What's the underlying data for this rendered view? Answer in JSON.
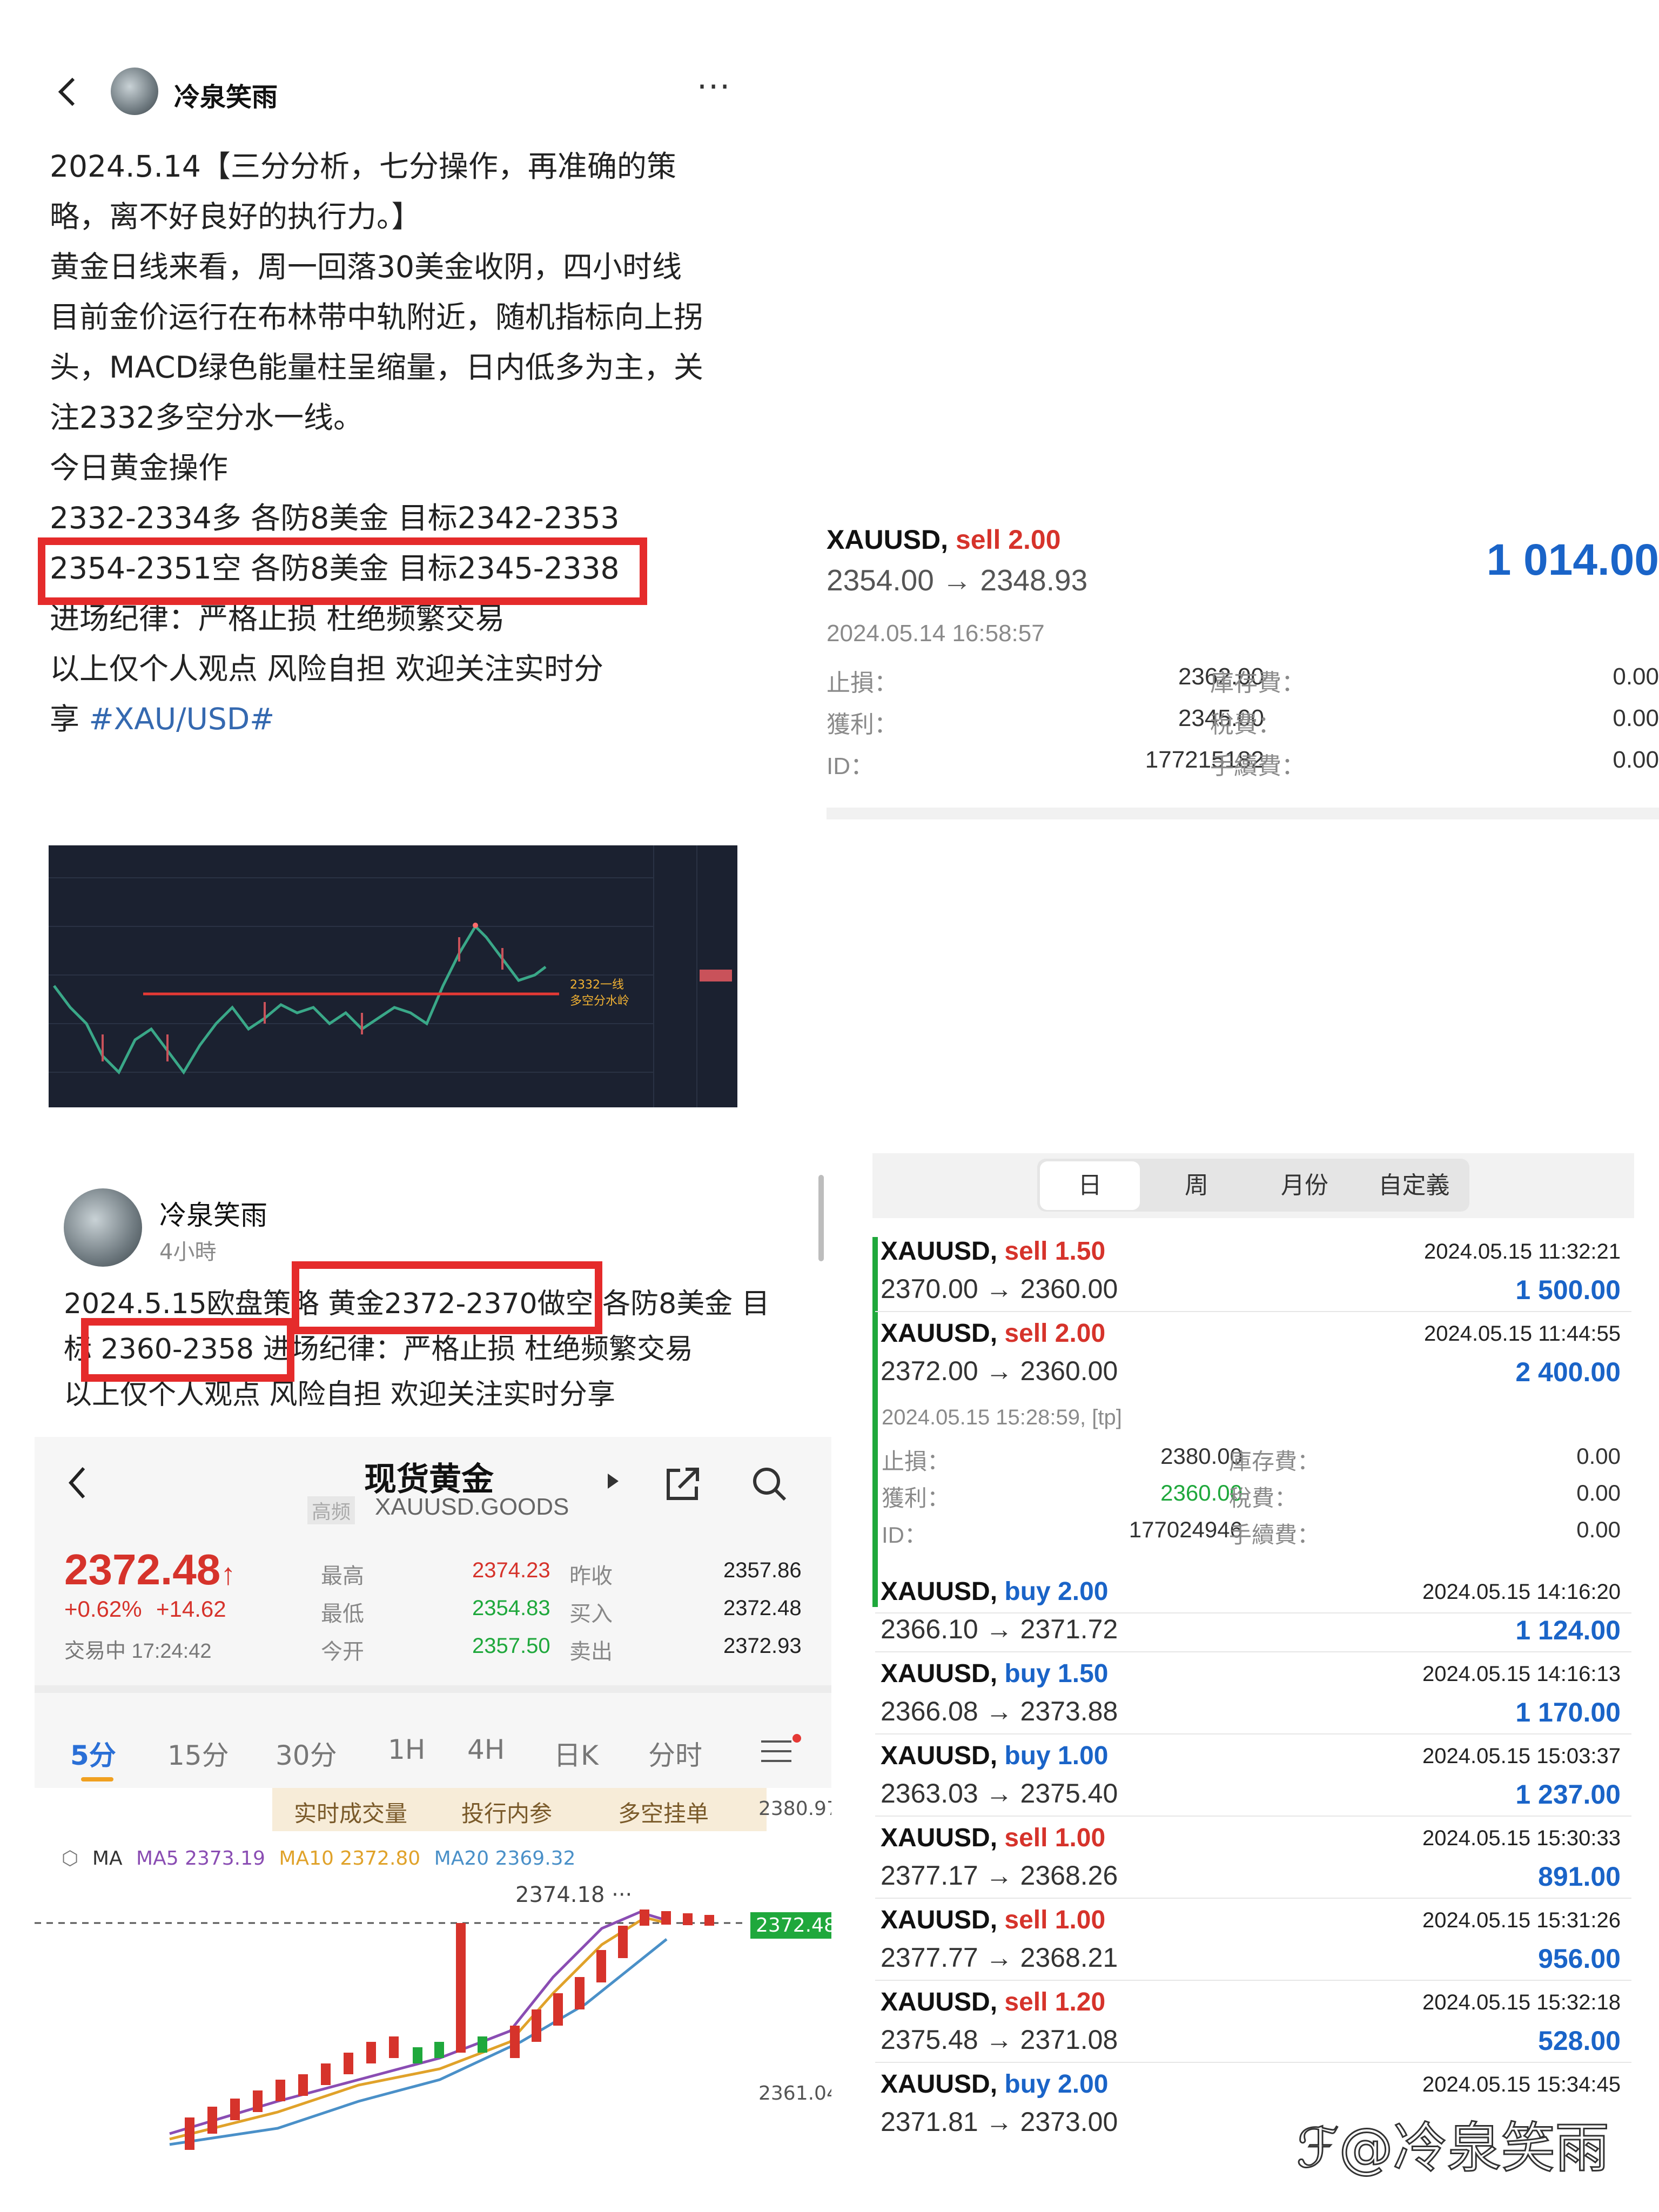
{
  "post1": {
    "author": "冷泉笑雨",
    "more": "···",
    "lines": [
      "2024.5.14【三分分析，七分操作，再准确的策",
      "略，离不好良好的执行力。】",
      "黄金日线来看，周一回落30美金收阴，四小时线",
      "目前金价运行在布林带中轨附近，随机指标向上拐",
      "头，MACD绿色能量柱呈缩量，日内低多为主，关",
      "注2332多空分水一线。",
      "今日黄金操作",
      "2332-2334多 各防8美金 目标2342-2353",
      "2354-2351空 各防8美金 目标2345-2338",
      "进场纪律：严格止损 杜绝频繁交易",
      "以上仅个人观点 风险自担 欢迎关注实时分"
    ],
    "last_line_prefix": "享 ",
    "hashtag": "#XAU/USD#",
    "chart_note_1": "2332一线",
    "chart_note_2": "多空分水岭"
  },
  "order1": {
    "symbol": "XAUUSD,",
    "side": "sell 2.00",
    "prices": "2354.00 → 2348.93",
    "profit": "1 014.00",
    "time": "2024.05.14 16:58:57",
    "rows": [
      {
        "k1": "止損：",
        "v1": "2362.00",
        "k2": "庫存費：",
        "v2": "0.00"
      },
      {
        "k1": "獲利：",
        "v1": "2345.00",
        "k2": "稅費：",
        "v2": "0.00"
      },
      {
        "k1": "ID：",
        "v1": "177215182",
        "k2": "手續費：",
        "v2": "0.00"
      }
    ]
  },
  "post2": {
    "author": "冷泉笑雨",
    "time_ago": "4小時",
    "lines": [
      "2024.5.15欧盘策略 黄金2372-2370做空 各防8美金 目",
      "标 2360-2358 进场纪律：严格止损 杜绝频繁交易",
      "以上仅个人观点 风险自担 欢迎关注实时分享"
    ]
  },
  "quote": {
    "title": "现货黄金",
    "badge": "高频",
    "code": "XAUUSD.GOODS",
    "price": "2372.48",
    "change_pct": "+0.62%",
    "change": "+14.62",
    "status": "交易中 17:24:42",
    "stats": [
      {
        "l1": "最高",
        "v1": "2374.23",
        "l2": "昨收",
        "v2": "2357.86"
      },
      {
        "l1": "最低",
        "v1": "2354.83",
        "l2": "买入",
        "v2": "2372.48"
      },
      {
        "l1": "今开",
        "v1": "2357.50",
        "l2": "卖出",
        "v2": "2372.93"
      }
    ],
    "tabs": [
      "5分",
      "15分",
      "30分",
      "1H",
      "4H",
      "日K",
      "分时"
    ],
    "sub_tabs": [
      "实时成交量",
      "投行内参",
      "多空挂单"
    ],
    "ma_label": "MA",
    "ma5": "MA5 2373.19",
    "ma10": "MA10 2372.80",
    "ma20": "MA20 2369.32",
    "high_mark": "2374.18 ···",
    "axis_top": "2380.97",
    "axis_price": "2372.48",
    "axis_bottom": "2361.04"
  },
  "history": {
    "segments": [
      "日",
      "周",
      "月份",
      "自定義"
    ],
    "trades": [
      {
        "symbol": "XAUUSD,",
        "side": "sell 1.50",
        "type": "sell",
        "prices": "2370.00 → 2360.00",
        "time": "2024.05.15 11:32:21",
        "profit": "1 500.00"
      },
      {
        "symbol": "XAUUSD,",
        "side": "sell 2.00",
        "type": "sell",
        "prices": "2372.00 → 2360.00",
        "time": "2024.05.15 11:44:55",
        "profit": "2 400.00"
      },
      {
        "symbol": "XAUUSD,",
        "side": "buy 2.00",
        "type": "buy",
        "prices": "2366.10 → 2371.72",
        "time": "2024.05.15 14:16:20",
        "profit": "1 124.00"
      },
      {
        "symbol": "XAUUSD,",
        "side": "buy 1.50",
        "type": "buy",
        "prices": "2366.08 → 2373.88",
        "time": "2024.05.15 14:16:13",
        "profit": "1 170.00"
      },
      {
        "symbol": "XAUUSD,",
        "side": "buy 1.00",
        "type": "buy",
        "prices": "2363.03 → 2375.40",
        "time": "2024.05.15 15:03:37",
        "profit": "1 237.00"
      },
      {
        "symbol": "XAUUSD,",
        "side": "sell 1.00",
        "type": "sell",
        "prices": "2377.17 → 2368.26",
        "time": "2024.05.15 15:30:33",
        "profit": "891.00"
      },
      {
        "symbol": "XAUUSD,",
        "side": "sell 1.00",
        "type": "sell",
        "prices": "2377.77 → 2368.21",
        "time": "2024.05.15 15:31:26",
        "profit": "956.00"
      },
      {
        "symbol": "XAUUSD,",
        "side": "sell 1.20",
        "type": "sell",
        "prices": "2375.48 → 2371.08",
        "time": "2024.05.15 15:32:18",
        "profit": "528.00"
      },
      {
        "symbol": "XAUUSD,",
        "side": "buy 2.00",
        "type": "buy",
        "prices": "2371.81 → 2373.00",
        "time": "2024.05.15 15:34:45",
        "profit": ""
      }
    ],
    "expanded": {
      "time": "2024.05.15 15:28:59, [tp]",
      "rows": [
        {
          "k1": "止損：",
          "v1": "2380.00",
          "k2": "庫存費：",
          "v2": "0.00"
        },
        {
          "k1": "獲利：",
          "v1": "2360.00",
          "k2": "稅費：",
          "v2": "0.00"
        },
        {
          "k1": "ID：",
          "v1": "177024946",
          "k2": "手續費：",
          "v2": "0.00"
        }
      ]
    }
  },
  "watermark": "@冷泉笑雨"
}
